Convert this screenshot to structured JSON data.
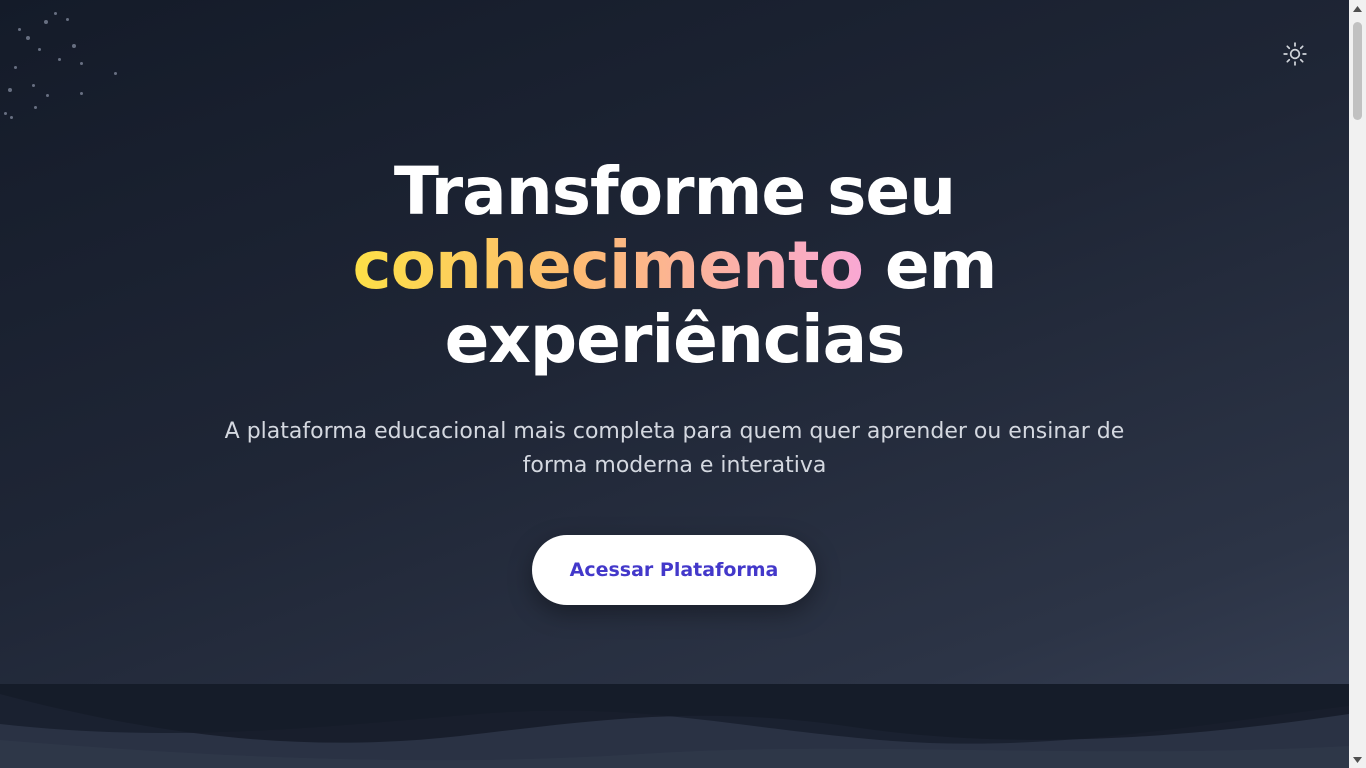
{
  "hero": {
    "title_line1": "Transforme seu",
    "title_accent": "conhecimento",
    "title_line2_rest": " em",
    "title_line3": "experiências",
    "subtitle": "A plataforma educacional mais completa para quem quer aprender ou ensinar de forma moderna e interativa",
    "cta_label": "Acessar Plataforma"
  },
  "header": {
    "theme_toggle_icon": "sun-icon"
  },
  "colors": {
    "background_dark": "#1f2636",
    "accent_gradient": [
      "#fde047",
      "#fdba74",
      "#f9a8d4"
    ],
    "cta_text": "#4338ca",
    "cta_background": "#ffffff"
  }
}
